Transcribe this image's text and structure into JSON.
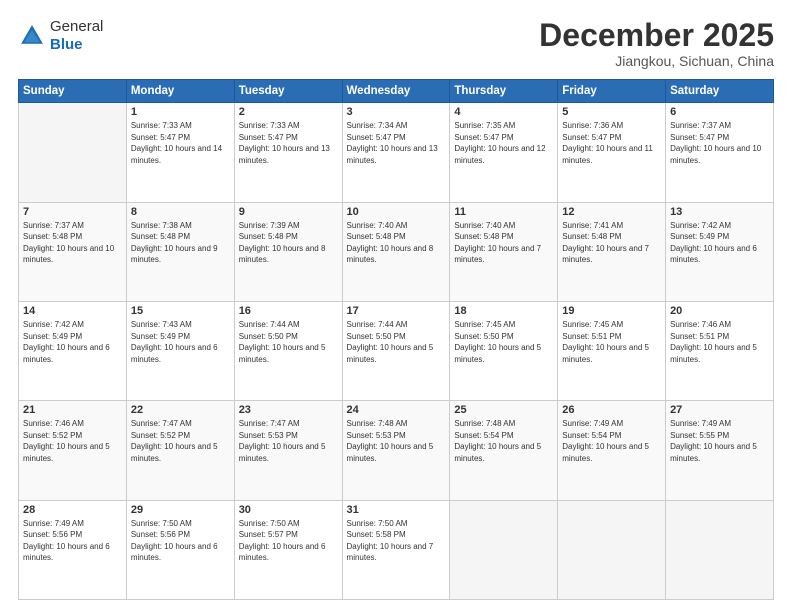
{
  "header": {
    "logo": {
      "line1": "General",
      "line2": "Blue"
    },
    "title": "December 2025",
    "subtitle": "Jiangkou, Sichuan, China"
  },
  "days_of_week": [
    "Sunday",
    "Monday",
    "Tuesday",
    "Wednesday",
    "Thursday",
    "Friday",
    "Saturday"
  ],
  "weeks": [
    [
      {
        "day": "",
        "empty": true
      },
      {
        "day": "1",
        "sunrise": "7:33 AM",
        "sunset": "5:47 PM",
        "daylight": "10 hours and 14 minutes."
      },
      {
        "day": "2",
        "sunrise": "7:33 AM",
        "sunset": "5:47 PM",
        "daylight": "10 hours and 13 minutes."
      },
      {
        "day": "3",
        "sunrise": "7:34 AM",
        "sunset": "5:47 PM",
        "daylight": "10 hours and 13 minutes."
      },
      {
        "day": "4",
        "sunrise": "7:35 AM",
        "sunset": "5:47 PM",
        "daylight": "10 hours and 12 minutes."
      },
      {
        "day": "5",
        "sunrise": "7:36 AM",
        "sunset": "5:47 PM",
        "daylight": "10 hours and 11 minutes."
      },
      {
        "day": "6",
        "sunrise": "7:37 AM",
        "sunset": "5:47 PM",
        "daylight": "10 hours and 10 minutes."
      }
    ],
    [
      {
        "day": "7",
        "sunrise": "7:37 AM",
        "sunset": "5:48 PM",
        "daylight": "10 hours and 10 minutes."
      },
      {
        "day": "8",
        "sunrise": "7:38 AM",
        "sunset": "5:48 PM",
        "daylight": "10 hours and 9 minutes."
      },
      {
        "day": "9",
        "sunrise": "7:39 AM",
        "sunset": "5:48 PM",
        "daylight": "10 hours and 8 minutes."
      },
      {
        "day": "10",
        "sunrise": "7:40 AM",
        "sunset": "5:48 PM",
        "daylight": "10 hours and 8 minutes."
      },
      {
        "day": "11",
        "sunrise": "7:40 AM",
        "sunset": "5:48 PM",
        "daylight": "10 hours and 7 minutes."
      },
      {
        "day": "12",
        "sunrise": "7:41 AM",
        "sunset": "5:48 PM",
        "daylight": "10 hours and 7 minutes."
      },
      {
        "day": "13",
        "sunrise": "7:42 AM",
        "sunset": "5:49 PM",
        "daylight": "10 hours and 6 minutes."
      }
    ],
    [
      {
        "day": "14",
        "sunrise": "7:42 AM",
        "sunset": "5:49 PM",
        "daylight": "10 hours and 6 minutes."
      },
      {
        "day": "15",
        "sunrise": "7:43 AM",
        "sunset": "5:49 PM",
        "daylight": "10 hours and 6 minutes."
      },
      {
        "day": "16",
        "sunrise": "7:44 AM",
        "sunset": "5:50 PM",
        "daylight": "10 hours and 5 minutes."
      },
      {
        "day": "17",
        "sunrise": "7:44 AM",
        "sunset": "5:50 PM",
        "daylight": "10 hours and 5 minutes."
      },
      {
        "day": "18",
        "sunrise": "7:45 AM",
        "sunset": "5:50 PM",
        "daylight": "10 hours and 5 minutes."
      },
      {
        "day": "19",
        "sunrise": "7:45 AM",
        "sunset": "5:51 PM",
        "daylight": "10 hours and 5 minutes."
      },
      {
        "day": "20",
        "sunrise": "7:46 AM",
        "sunset": "5:51 PM",
        "daylight": "10 hours and 5 minutes."
      }
    ],
    [
      {
        "day": "21",
        "sunrise": "7:46 AM",
        "sunset": "5:52 PM",
        "daylight": "10 hours and 5 minutes."
      },
      {
        "day": "22",
        "sunrise": "7:47 AM",
        "sunset": "5:52 PM",
        "daylight": "10 hours and 5 minutes."
      },
      {
        "day": "23",
        "sunrise": "7:47 AM",
        "sunset": "5:53 PM",
        "daylight": "10 hours and 5 minutes."
      },
      {
        "day": "24",
        "sunrise": "7:48 AM",
        "sunset": "5:53 PM",
        "daylight": "10 hours and 5 minutes."
      },
      {
        "day": "25",
        "sunrise": "7:48 AM",
        "sunset": "5:54 PM",
        "daylight": "10 hours and 5 minutes."
      },
      {
        "day": "26",
        "sunrise": "7:49 AM",
        "sunset": "5:54 PM",
        "daylight": "10 hours and 5 minutes."
      },
      {
        "day": "27",
        "sunrise": "7:49 AM",
        "sunset": "5:55 PM",
        "daylight": "10 hours and 5 minutes."
      }
    ],
    [
      {
        "day": "28",
        "sunrise": "7:49 AM",
        "sunset": "5:56 PM",
        "daylight": "10 hours and 6 minutes."
      },
      {
        "day": "29",
        "sunrise": "7:50 AM",
        "sunset": "5:56 PM",
        "daylight": "10 hours and 6 minutes."
      },
      {
        "day": "30",
        "sunrise": "7:50 AM",
        "sunset": "5:57 PM",
        "daylight": "10 hours and 6 minutes."
      },
      {
        "day": "31",
        "sunrise": "7:50 AM",
        "sunset": "5:58 PM",
        "daylight": "10 hours and 7 minutes."
      },
      {
        "day": "",
        "empty": true
      },
      {
        "day": "",
        "empty": true
      },
      {
        "day": "",
        "empty": true
      }
    ]
  ],
  "labels": {
    "sunrise": "Sunrise:",
    "sunset": "Sunset:",
    "daylight": "Daylight:"
  }
}
